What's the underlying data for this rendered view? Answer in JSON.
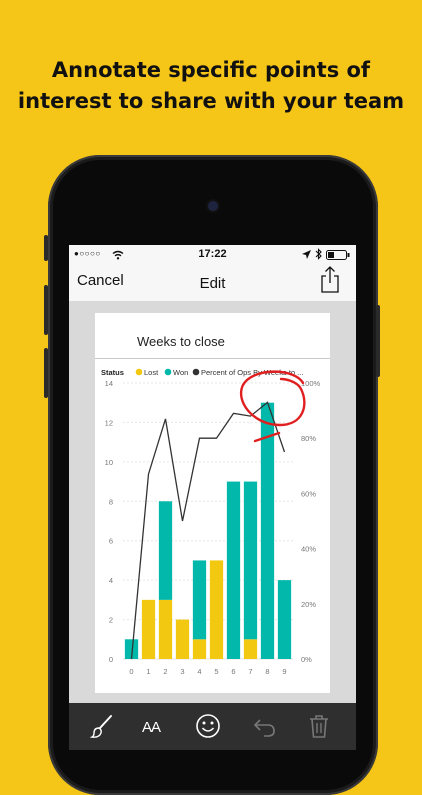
{
  "headline": {
    "line1": "Annotate specific points of",
    "line2": "interest to share with your team"
  },
  "status_bar": {
    "signal": "●○○○○",
    "time": "17:22"
  },
  "nav": {
    "cancel_label": "Cancel",
    "title": "Edit"
  },
  "toolbar": {
    "text_tool_label": "AA"
  },
  "colors": {
    "background": "#F5C518",
    "lost": "#F2C811",
    "won": "#01B8AA",
    "line": "#333333",
    "annotation": "#E02020"
  },
  "chart_data": {
    "type": "bar",
    "title": "Weeks to close",
    "legend_title": "Status",
    "legend_position": "top-left",
    "categories": [
      "0",
      "1",
      "2",
      "3",
      "4",
      "5",
      "6",
      "7",
      "8",
      "9"
    ],
    "series": [
      {
        "name": "Lost",
        "kind": "bar",
        "values": [
          0,
          3,
          3,
          2,
          1,
          5,
          0,
          1,
          0,
          0
        ]
      },
      {
        "name": "Won",
        "kind": "bar",
        "values": [
          1,
          0,
          5,
          0,
          4,
          0,
          9,
          8,
          13,
          4
        ]
      },
      {
        "name": "Percent of Ops By Weeks to ...",
        "kind": "line",
        "axis": "right",
        "values": [
          0.0,
          0.67,
          0.87,
          0.5,
          0.8,
          0.8,
          0.89,
          0.88,
          0.93,
          0.75
        ]
      }
    ],
    "y_ticks": [
      "0",
      "2",
      "4",
      "6",
      "8",
      "10",
      "12",
      "14"
    ],
    "y_right_ticks": [
      "0%",
      "20%",
      "40%",
      "60%",
      "80%",
      "100%"
    ],
    "ylim": [
      0,
      14
    ],
    "y2lim": [
      0,
      1
    ],
    "grid": true
  }
}
